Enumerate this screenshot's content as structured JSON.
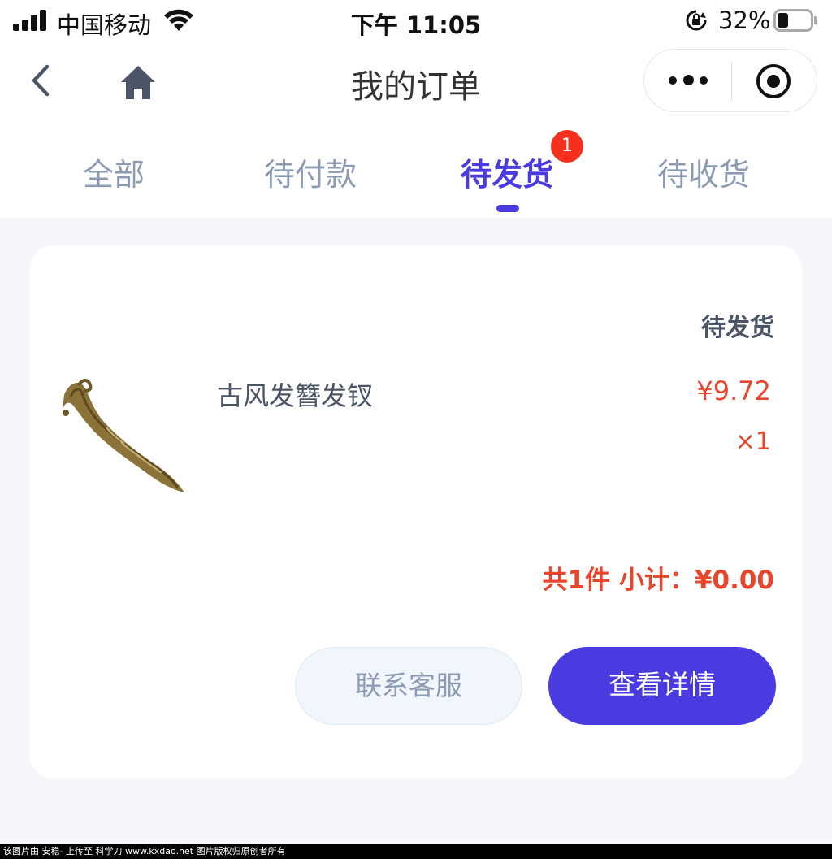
{
  "status_bar": {
    "carrier": "中国移动",
    "time": "下午 11:05",
    "battery_percent": "32%",
    "battery_level": 0.32,
    "signal_bars": 4
  },
  "nav": {
    "title": "我的订单",
    "back_icon": "chevron-left-icon",
    "home_icon": "home-icon",
    "more_icon": "more-dots-icon",
    "close_icon": "target-close-icon"
  },
  "tabs": [
    {
      "label": "全部",
      "active": false
    },
    {
      "label": "待付款",
      "active": false
    },
    {
      "label": "待发货",
      "active": true,
      "badge": "1"
    },
    {
      "label": "待收货",
      "active": false
    }
  ],
  "order": {
    "status": "待发货",
    "product_name": "古风发簪发钗",
    "price": "¥9.72",
    "quantity": "×1",
    "subtotal": "共1件 小计：¥0.00",
    "buttons": {
      "service": "联系客服",
      "detail": "查看详情"
    }
  },
  "colors": {
    "accent": "#4a3be0",
    "price_red": "#e8462c",
    "badge_red": "#f5301f",
    "tab_inactive": "#8c9bb2",
    "background": "#f5f6fa"
  },
  "footer": {
    "watermark": "该图片由 安稳- 上传至 科学刀 www.kxdao.net 图片版权归原创者所有"
  }
}
